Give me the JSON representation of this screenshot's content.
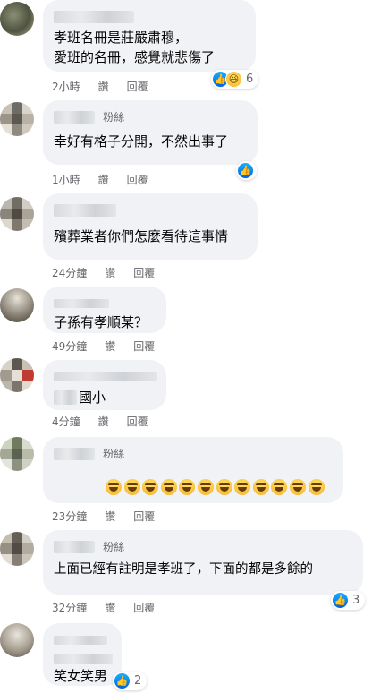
{
  "comments": [
    {
      "text": "孝班名冊是莊嚴肅穆，\n愛班的名冊，感覺就悲傷了",
      "time": "2小時",
      "reply_label": "讚",
      "respond_label": "回覆",
      "reaction_count": "6",
      "reactions": [
        "like-icon",
        "haha-icon"
      ]
    },
    {
      "name_suffix": "粉絲",
      "text": "幸好有格子分開，不然出事了",
      "time": "1小時",
      "reply_label": "讚",
      "respond_label": "回覆",
      "reactions": [
        "like-icon"
      ]
    },
    {
      "text": "殯葬業者你們怎麼看待這事情",
      "time": "24分鐘",
      "reply_label": "讚",
      "respond_label": "回覆"
    },
    {
      "text": "子孫有孝順某？",
      "time": "49分鐘",
      "reply_label": "讚",
      "respond_label": "回覆"
    },
    {
      "text": "國小",
      "time": "4分鐘",
      "reply_label": "讚",
      "respond_label": "回覆"
    },
    {
      "name_suffix": "粉絲",
      "emoji_count": 12,
      "time": "23分鐘",
      "reply_label": "讚",
      "respond_label": "回覆"
    },
    {
      "name_suffix": "粉絲",
      "text": "上面已經有註明是孝班了，下面的都是多餘的",
      "time": "32分鐘",
      "reply_label": "讚",
      "respond_label": "回覆",
      "reaction_count": "3",
      "reactions": [
        "like-icon"
      ]
    },
    {
      "text": "笑女笑男",
      "reaction_count": "2",
      "reactions": [
        "like-icon"
      ]
    }
  ],
  "colors": {
    "bubble": "#f0f2f5",
    "meta_text": "#65676b",
    "like_blue": "#0a7cff",
    "haha_yellow": "#f7b125"
  }
}
